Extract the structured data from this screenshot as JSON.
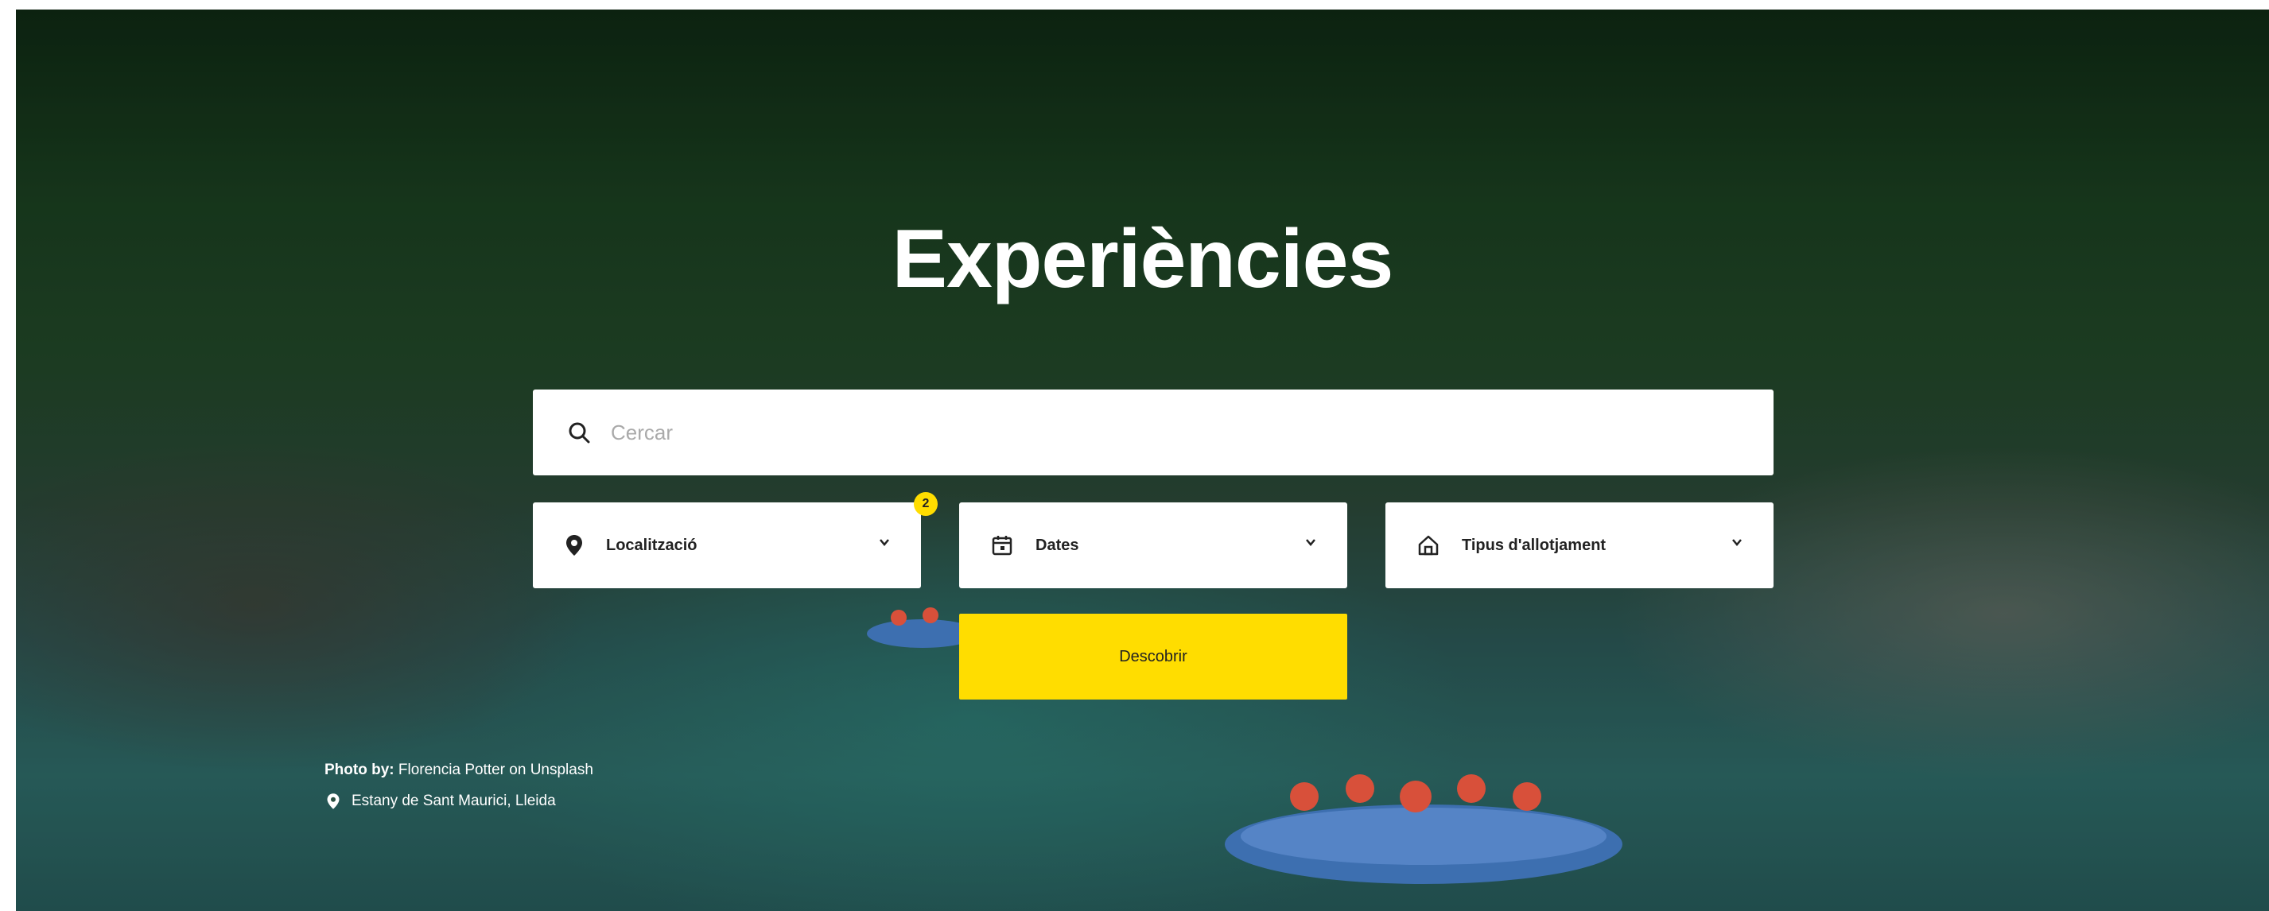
{
  "hero": {
    "title": "Experiències",
    "background_colors": {
      "forest": "#1c4222",
      "river": "#2f6d6a"
    }
  },
  "search": {
    "placeholder": "Cercar",
    "icon": "search-icon"
  },
  "filters": [
    {
      "label": "Localització",
      "icon": "map-pin-icon",
      "badge": "2"
    },
    {
      "label": "Dates",
      "icon": "calendar-icon"
    },
    {
      "label": "Tipus d'allotjament",
      "icon": "house-icon"
    }
  ],
  "actions": {
    "discover_label": "Descobrir"
  },
  "credit": {
    "prefix": "Photo by:",
    "text": "Florencia Potter on Unsplash",
    "location": "Estany de Sant Maurici, Lleida"
  },
  "colors": {
    "accent": "#FFDD00",
    "text": "#222222",
    "white": "#FFFFFF"
  }
}
